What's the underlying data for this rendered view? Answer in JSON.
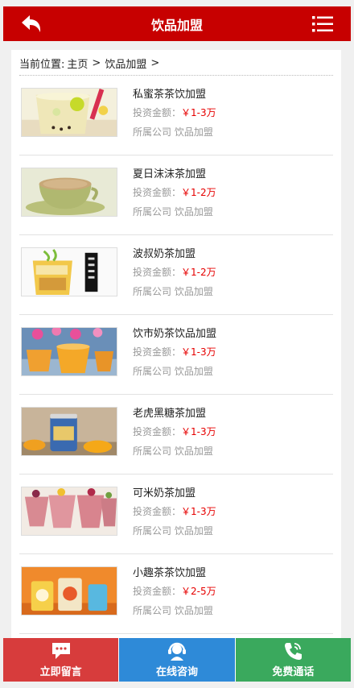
{
  "header": {
    "title": "饮品加盟",
    "back_icon": "back-arrow-icon",
    "menu_icon": "list-menu-icon"
  },
  "breadcrumb": {
    "prefix": "当前位置:",
    "home": "主页",
    "sep1": ">",
    "category": "饮品加盟",
    "sep2": ">"
  },
  "items": [
    {
      "title": "私蜜茶茶饮加盟",
      "price_label": "投资金额：",
      "price": "￥1-3万",
      "company": "所属公司 饮品加盟"
    },
    {
      "title": "夏日沫沫茶加盟",
      "price_label": "投资金额：",
      "price": "￥1-2万",
      "company": "所属公司 饮品加盟"
    },
    {
      "title": "波叔奶茶加盟",
      "price_label": "投资金额：",
      "price": "￥1-2万",
      "company": "所属公司 饮品加盟"
    },
    {
      "title": "饮市奶茶饮品加盟",
      "price_label": "投资金额：",
      "price": "￥1-3万",
      "company": "所属公司 饮品加盟"
    },
    {
      "title": "老虎黑糖茶加盟",
      "price_label": "投资金额：",
      "price": "￥1-3万",
      "company": "所属公司 饮品加盟"
    },
    {
      "title": "可米奶茶加盟",
      "price_label": "投资金额：",
      "price": "￥1-3万",
      "company": "所属公司 饮品加盟"
    },
    {
      "title": "小趣茶茶饮加盟",
      "price_label": "投资金额：",
      "price": "￥2-5万",
      "company": "所属公司 饮品加盟"
    }
  ],
  "footer": {
    "message_label": "立即留言",
    "consult_label": "在线咨询",
    "call_label": "免费通话",
    "colors": {
      "message": "#d73c3c",
      "consult": "#2e8ad8",
      "call": "#3aa95d"
    }
  },
  "colors": {
    "header": "#c70000",
    "price": "#e60000"
  }
}
